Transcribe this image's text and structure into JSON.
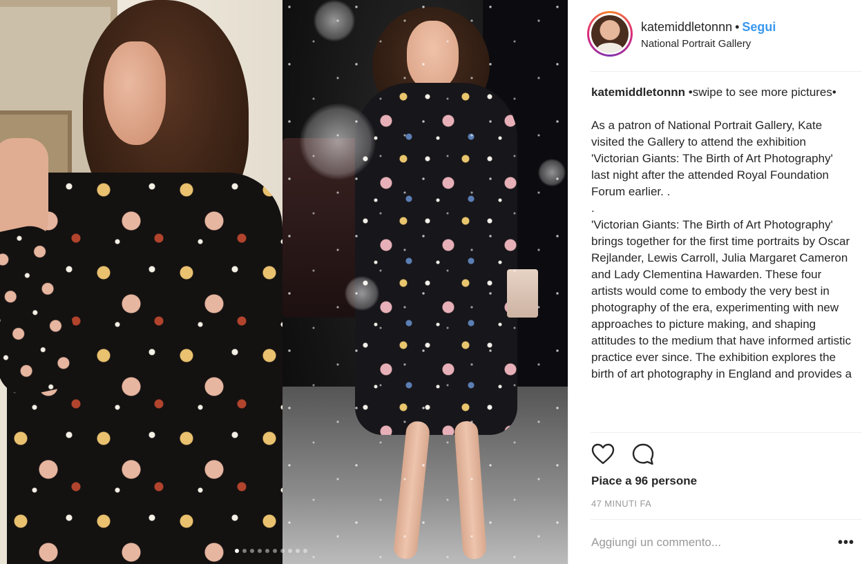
{
  "post": {
    "username": "katemiddletonnn",
    "separator": "•",
    "follow_label": "Segui",
    "location": "National Portrait Gallery",
    "caption": {
      "user": "katemiddletonnn",
      "lead": " •swipe to see more pictures•",
      "para1": "As a patron of National Portrait Gallery, Kate visited the Gallery to attend the exhibition 'Victorian Giants: The Birth of Art Photography' last night after the attended Royal Foundation Forum earlier. .",
      "para2": ".",
      "para3": "'Victorian Giants: The Birth of Art Photography' brings together for the first time portraits by Oscar Rejlander, Lewis Carroll, Julia Margaret Cameron and Lady Clementina Hawarden. These four artists would come to embody the very best in photography of the era, experimenting with new approaches to picture making, and shaping attitudes to the medium that have informed artistic practice ever since. The exhibition explores the birth of art photography in England and provides a"
    },
    "likes": "Piace a 96 persone",
    "timestamp": "47 MINUTI FA",
    "comment_placeholder": "Aggiungi un commento...",
    "more_label": "•••"
  },
  "carousel": {
    "slide_count": 10,
    "active_index": 0
  },
  "colors": {
    "link": "#3897f0",
    "text": "#262626",
    "muted": "#999999",
    "divider": "#efefef"
  },
  "icons": {
    "like": "heart-icon",
    "comment": "comment-icon",
    "more": "more-options-icon"
  }
}
